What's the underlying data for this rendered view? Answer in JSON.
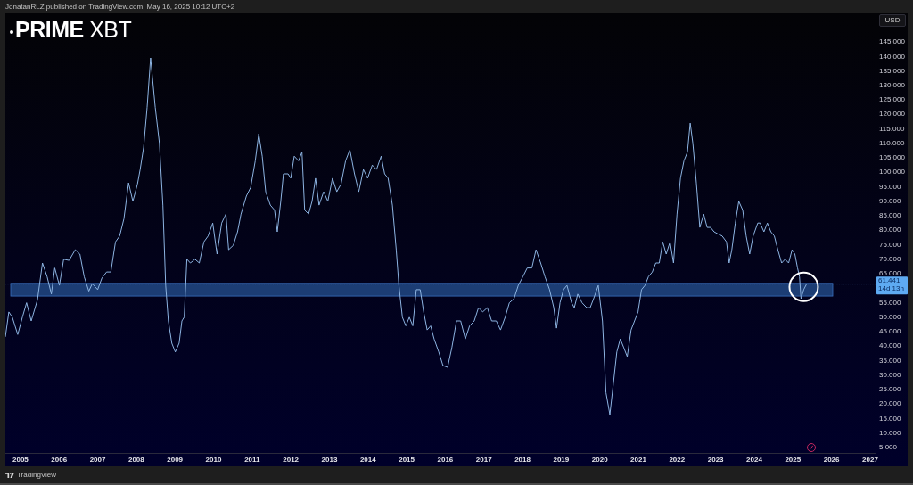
{
  "header": {
    "attribution": "JonatanRLZ published on TradingView.com, May 16, 2025 10:12 UTC+2"
  },
  "logo": {
    "text": "**PRIME** XBT"
  },
  "price_scale": {
    "currency_button": "USD",
    "last_price": "61.441",
    "countdown": "14d 13h"
  },
  "chart": {
    "last_point_circled": true,
    "chart_data": {
      "type": "line",
      "x": [
        2004.61,
        2004.7,
        2004.79,
        2004.93,
        2005.05,
        2005.16,
        2005.28,
        2005.44,
        2005.57,
        2005.69,
        2005.8,
        2005.89,
        2006.01,
        2006.12,
        2006.26,
        2006.42,
        2006.54,
        2006.65,
        2006.77,
        2006.86,
        2007.0,
        2007.11,
        2007.23,
        2007.34,
        2007.46,
        2007.57,
        2007.68,
        2007.8,
        2007.91,
        2008.03,
        2008.1,
        2008.19,
        2008.28,
        2008.37,
        2008.49,
        2008.6,
        2008.69,
        2008.76,
        2008.83,
        2008.92,
        2009.01,
        2009.11,
        2009.18,
        2009.24,
        2009.31,
        2009.4,
        2009.52,
        2009.63,
        2009.75,
        2009.86,
        2009.98,
        2010.09,
        2010.21,
        2010.32,
        2010.39,
        2010.51,
        2010.62,
        2010.71,
        2010.85,
        2010.96,
        2011.08,
        2011.17,
        2011.26,
        2011.35,
        2011.47,
        2011.58,
        2011.65,
        2011.74,
        2011.81,
        2011.93,
        2012.0,
        2012.09,
        2012.2,
        2012.29,
        2012.36,
        2012.46,
        2012.55,
        2012.64,
        2012.73,
        2012.85,
        2012.96,
        2013.08,
        2013.19,
        2013.3,
        2013.42,
        2013.53,
        2013.65,
        2013.76,
        2013.88,
        2013.99,
        2014.11,
        2014.22,
        2014.34,
        2014.43,
        2014.52,
        2014.63,
        2014.73,
        2014.8,
        2014.89,
        2014.98,
        2015.07,
        2015.16,
        2015.25,
        2015.35,
        2015.44,
        2015.53,
        2015.62,
        2015.71,
        2015.83,
        2015.94,
        2016.06,
        2016.17,
        2016.29,
        2016.4,
        2016.52,
        2016.63,
        2016.75,
        2016.86,
        2016.97,
        2017.09,
        2017.2,
        2017.32,
        2017.43,
        2017.55,
        2017.66,
        2017.78,
        2017.89,
        2018.01,
        2018.12,
        2018.24,
        2018.35,
        2018.47,
        2018.58,
        2018.7,
        2018.81,
        2018.88,
        2018.97,
        2019.06,
        2019.15,
        2019.27,
        2019.34,
        2019.43,
        2019.54,
        2019.66,
        2019.75,
        2019.84,
        2019.96,
        2020.07,
        2020.16,
        2020.26,
        2020.35,
        2020.44,
        2020.53,
        2020.62,
        2020.71,
        2020.81,
        2020.9,
        2020.99,
        2021.08,
        2021.17,
        2021.26,
        2021.36,
        2021.45,
        2021.54,
        2021.63,
        2021.72,
        2021.82,
        2021.91,
        2022.0,
        2022.09,
        2022.18,
        2022.27,
        2022.34,
        2022.41,
        2022.5,
        2022.59,
        2022.69,
        2022.78,
        2022.87,
        2022.96,
        2023.05,
        2023.17,
        2023.28,
        2023.35,
        2023.42,
        2023.51,
        2023.6,
        2023.7,
        2023.79,
        2023.88,
        2023.97,
        2024.09,
        2024.15,
        2024.25,
        2024.34,
        2024.43,
        2024.52,
        2024.61,
        2024.71,
        2024.8,
        2024.89,
        2024.98,
        2025.05,
        2025.12,
        2025.17,
        2025.21,
        2025.28,
        2025.35
      ],
      "series": [
        {
          "color": "#8db4e2",
          "values": [
            43.2,
            51.8,
            50.0,
            44.0,
            50.0,
            55.0,
            48.7,
            56.0,
            68.7,
            64.0,
            58.0,
            67.0,
            61.0,
            70.0,
            69.6,
            73.3,
            71.8,
            64.0,
            59.0,
            61.6,
            59.5,
            63.5,
            65.6,
            65.6,
            76.0,
            78.0,
            84.0,
            96.4,
            90.0,
            96.0,
            101.0,
            108.7,
            122.5,
            139.5,
            122.5,
            110.0,
            88.7,
            61.0,
            48.7,
            41.0,
            38.0,
            41.0,
            48.7,
            50.0,
            70.0,
            68.7,
            70.0,
            68.7,
            76.0,
            78.0,
            82.5,
            71.8,
            82.5,
            85.6,
            73.3,
            74.8,
            79.5,
            85.6,
            91.8,
            94.8,
            104.0,
            113.3,
            105.6,
            93.3,
            88.7,
            87.0,
            79.5,
            90.0,
            99.5,
            99.5,
            98.0,
            105.6,
            104.0,
            107.0,
            87.0,
            85.6,
            90.0,
            98.0,
            88.7,
            93.3,
            90.0,
            98.0,
            93.3,
            96.0,
            104.0,
            107.8,
            99.5,
            93.3,
            101.0,
            98.0,
            102.5,
            101.0,
            105.6,
            99.5,
            98.0,
            88.7,
            73.3,
            61.0,
            50.0,
            47.0,
            50.0,
            47.0,
            59.5,
            59.5,
            51.8,
            45.6,
            47.0,
            42.5,
            38.0,
            33.3,
            32.7,
            39.5,
            48.7,
            48.7,
            42.5,
            47.0,
            48.7,
            53.3,
            51.8,
            53.3,
            48.7,
            48.7,
            45.6,
            50.0,
            55.0,
            56.4,
            61.0,
            64.0,
            67.0,
            67.0,
            73.3,
            68.7,
            64.0,
            59.5,
            53.3,
            46.2,
            55.0,
            59.5,
            61.0,
            55.0,
            53.3,
            58.0,
            55.0,
            53.3,
            53.3,
            56.4,
            61.0,
            48.7,
            24.0,
            16.4,
            27.0,
            38.0,
            42.5,
            39.5,
            36.4,
            45.6,
            48.7,
            51.8,
            59.5,
            61.0,
            64.0,
            65.6,
            68.7,
            68.7,
            76.0,
            71.8,
            76.0,
            68.7,
            85.6,
            98.0,
            104.0,
            107.0,
            117.0,
            110.0,
            96.4,
            81.0,
            85.6,
            81.0,
            81.0,
            79.5,
            78.8,
            78.0,
            76.0,
            68.7,
            73.3,
            82.5,
            90.0,
            87.0,
            78.0,
            71.8,
            78.0,
            82.5,
            82.5,
            79.5,
            82.5,
            79.5,
            78.0,
            73.3,
            68.7,
            70.0,
            68.7,
            73.3,
            71.8,
            67.0,
            64.0,
            56.4,
            59.5,
            61.4
          ]
        }
      ],
      "xlim": [
        2004.61,
        2027.14
      ],
      "ylim": [
        3.15,
        154.9
      ],
      "xticks": [
        2005,
        2006,
        2007,
        2008,
        2009,
        2010,
        2011,
        2012,
        2013,
        2014,
        2015,
        2016,
        2017,
        2018,
        2019,
        2020,
        2021,
        2022,
        2023,
        2024,
        2025,
        2026,
        2027
      ],
      "yticks": [
        {
          "value": 5,
          "label": "5.000"
        },
        {
          "value": 10,
          "label": "10.000"
        },
        {
          "value": 15,
          "label": "15.000"
        },
        {
          "value": 20,
          "label": "20.000"
        },
        {
          "value": 25,
          "label": "25.000"
        },
        {
          "value": 30,
          "label": "30.000"
        },
        {
          "value": 35,
          "label": "35.000"
        },
        {
          "value": 40,
          "label": "40.000"
        },
        {
          "value": 45,
          "label": "45.000"
        },
        {
          "value": 50,
          "label": "50.000"
        },
        {
          "value": 55,
          "label": "55.000"
        },
        {
          "value": 65,
          "label": "65.000"
        },
        {
          "value": 70,
          "label": "70.000"
        },
        {
          "value": 75,
          "label": "75.000"
        },
        {
          "value": 80,
          "label": "80.000"
        },
        {
          "value": 85,
          "label": "85.000"
        },
        {
          "value": 90,
          "label": "90.000"
        },
        {
          "value": 95,
          "label": "95.000"
        },
        {
          "value": 100,
          "label": "100.000"
        },
        {
          "value": 105,
          "label": "105.000"
        },
        {
          "value": 110,
          "label": "110.000"
        },
        {
          "value": 115,
          "label": "115.000"
        },
        {
          "value": 120,
          "label": "120.000"
        },
        {
          "value": 125,
          "label": "125.000"
        },
        {
          "value": 130,
          "label": "130.000"
        },
        {
          "value": 135,
          "label": "135.000"
        },
        {
          "value": 140,
          "label": "140.000"
        },
        {
          "value": 145,
          "label": "145.000"
        }
      ],
      "bands": [
        {
          "axis": "y",
          "from": 57.3,
          "to": 61.7
        }
      ],
      "ref_lines": [
        {
          "axis": "y",
          "value": 61.441
        }
      ]
    }
  },
  "footer": {
    "brand": "TradingView"
  }
}
